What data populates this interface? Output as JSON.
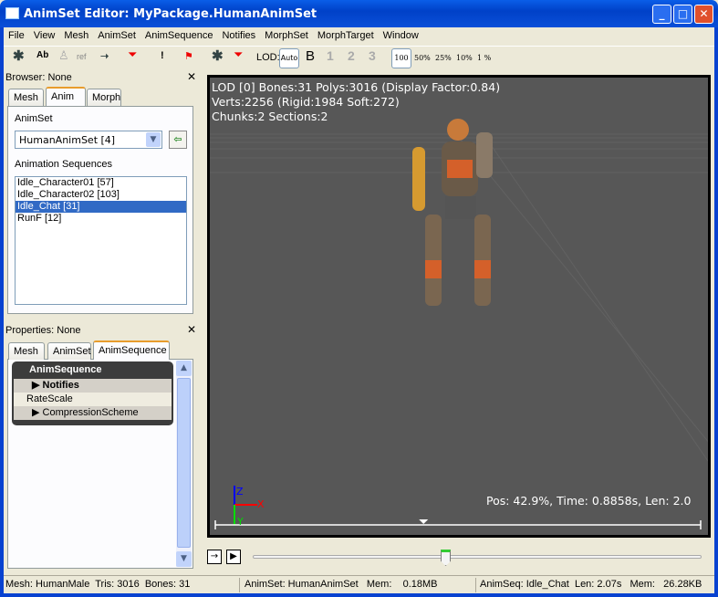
{
  "window": {
    "title": "AnimSet Editor: MyPackage.HumanAnimSet",
    "min": "_",
    "max": "□",
    "close": "✕"
  },
  "menu": [
    "File",
    "View",
    "Mesh",
    "AnimSet",
    "AnimSequence",
    "Notifies",
    "MorphSet",
    "MorphTarget",
    "Window"
  ],
  "toolbar": {
    "ab": "Ab",
    "ref": "ref",
    "exclaim": "!",
    "lod_label": "LOD:",
    "lod_auto": "Auto",
    "lod_b": "B",
    "lod_1": "1",
    "lod_2": "2",
    "lod_3": "3",
    "z100": "100",
    "z50": "50%",
    "z25": "25%",
    "z10": "10%",
    "z1": "1 %"
  },
  "browser": {
    "header": "Browser: None",
    "close": "✕",
    "tabs": [
      "Mesh",
      "Anim",
      "Morph"
    ],
    "active_tab": "Anim",
    "animset_label": "AnimSet",
    "animset_value": "HumanAnimSet [4]",
    "sequences_label": "Animation Sequences",
    "sequences": [
      "Idle_Character01 [57]",
      "Idle_Character02 [103]",
      "Idle_Chat [31]",
      "RunF [12]"
    ],
    "selected": "Idle_Chat [31]"
  },
  "properties": {
    "header": "Properties: None",
    "close": "✕",
    "tabs": [
      "Mesh",
      "AnimSet",
      "AnimSequence"
    ],
    "active_tab": "AnimSequence",
    "category": "AnimSequence",
    "rows": [
      "Notifies",
      "RateScale",
      "CompressionScheme"
    ]
  },
  "viewport": {
    "line1": "LOD [0] Bones:31 Polys:3016 (Display Factor:0.84)",
    "line2": "Verts:2256 (Rigid:1984 Soft:272)",
    "line3": "Chunks:2 Sections:2",
    "playback": "Pos: 42.9%, Time: 0.8858s, Len: 2.0",
    "axis_x": "X",
    "axis_y": "Y",
    "axis_z": "Z",
    "position_pct": 42.9
  },
  "status": {
    "mesh": "Mesh: HumanMale  Tris: 3016  Bones: 31",
    "animset": "AnimSet: HumanAnimSet   Mem:    0.18MB",
    "animseq": "AnimSeq: Idle_Chat  Len: 2.07s   Mem:   26.28KB"
  }
}
